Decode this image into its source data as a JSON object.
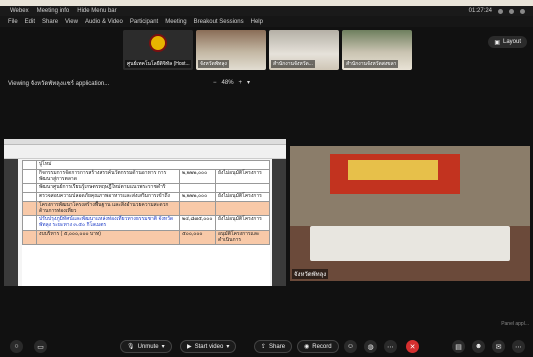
{
  "titlebar": {
    "app": "Webex",
    "meeting": "Meeting info",
    "more": "Hide Menu bar",
    "time": "01:27:24"
  },
  "menu": [
    "File",
    "Edit",
    "Share",
    "View",
    "Audio & Video",
    "Participant",
    "Meeting",
    "Breakout Sessions",
    "Help"
  ],
  "participants": [
    {
      "label": "ศูนย์เทคโนโลยีดิจิทัล (Host..."
    },
    {
      "label": "จังหวัดพัทลุง"
    },
    {
      "label": "สำนักงานจังหวัด..."
    },
    {
      "label": "สำนักงานจังหวัดสงขลา"
    }
  ],
  "layout_label": "Layout",
  "viewing_text": "Viewing จังหวัดพัทลุงแชร์ application...",
  "zoom_level": "48%",
  "doc": {
    "row_header": "ปูโหม่",
    "rows": [
      {
        "text": "กิจกรรมการจัดการการสร้างสรรค์นวัตกรรมด้านอาหาร การพัฒนาสู่การตลาด",
        "amount": "๒,๒๒๒,๐๐๐",
        "note": "ยังไม่อนุมัติโครงการ"
      },
      {
        "text": "พัฒนาศูนย์การเรียนรู้เกษตรทฤษฎีใหม่ตามแนวพระราชดำริ",
        "amount": "",
        "note": ""
      },
      {
        "text": "ตรวจสอบความปลอดภัยคุณภาพอาหารและส่งเสริมการเข้าถึง",
        "amount": "๒,๒๒๒,๐๐๐",
        "note": "ยังไม่อนุมัติโครงการ"
      },
      {
        "text": "โครงการพัฒนาโครงสร้างพื้นฐาน และสิ่งอำนวยความสะดวกด้านการท่องเที่ยว",
        "amount": "",
        "note": "",
        "highlight": true
      },
      {
        "text": "ปรับปรุงภูมิทัศน์และพัฒนาแหล่งท่องเที่ยวทางธรรมชาติ จังหวัดพัทลุง ระยะทาง ๓.๕๐ กิโลเมตร",
        "amount": "๒๔,๘๗๕,๐๐๐",
        "note": "ยังไม่อนุมัติโครงการ"
      },
      {
        "text": "งบบริหาร ( ๕,๐๐๐,๐๐๐ บาท)",
        "amount": "๕๐๐,๐๐๐",
        "note": "อนุมัติโครงการและดำเนินการ",
        "highlight": true
      }
    ]
  },
  "video_name": "จังหวัดพัทลุง",
  "controls": {
    "unmute": "Unmute",
    "start_video": "Start video",
    "share": "Share",
    "record": "Record"
  },
  "panel_note": "Panel appl..."
}
